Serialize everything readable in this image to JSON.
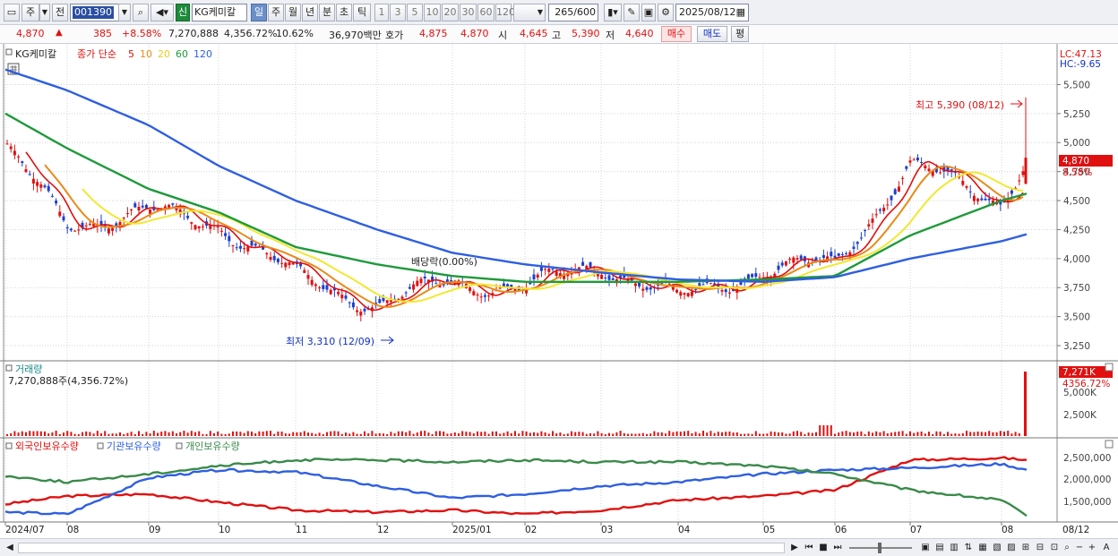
{
  "toolbar": {
    "market": "주",
    "prev_label": "전",
    "code": "001390",
    "new_badge": "신",
    "stock_name": "KG케미칼",
    "periods": [
      "일",
      "주",
      "월",
      "년",
      "분",
      "초",
      "틱"
    ],
    "active_period": "일",
    "intervals": [
      "1",
      "3",
      "5",
      "10",
      "20",
      "30",
      "60",
      "120"
    ],
    "page": "265/600",
    "date": "2025/08/12"
  },
  "quote": {
    "price": "4,870",
    "arrow": "▲",
    "change": "385",
    "change_pct": "+8.58%",
    "volume": "7,270,888",
    "volume_pct": "4,356.72%",
    "turnover": "10.62%",
    "amount": "36,970백만",
    "bid_label": "호가",
    "bid1": "4,875",
    "bid2": "4,870",
    "open_label": "시",
    "open": "4,645",
    "high_label": "고",
    "high": "5,390",
    "low_label": "저",
    "low": "4,640",
    "buy_label": "매수",
    "sell_label": "매도",
    "eval_label": "평"
  },
  "legend": {
    "name": "KG케미칼",
    "ma_label": "종가 단순",
    "ma_periods": [
      "5",
      "10",
      "20",
      "60",
      "120"
    ],
    "ma_colors": [
      "#e01010",
      "#e88a18",
      "#f2e830",
      "#1e9a3a",
      "#2f5fe0"
    ]
  },
  "price_axis": {
    "ticks": [
      "5,500",
      "5,250",
      "5,000",
      "4,750",
      "4,500",
      "4,250",
      "4,000",
      "3,750",
      "3,500",
      "3,250"
    ],
    "lc": "LC:47.13",
    "hc": "HC:-9.65",
    "current": "4,870",
    "current_pct": "8.58%"
  },
  "annotations": {
    "high": "최고 5,390 (08/12)",
    "low": "최저 3,310 (12/09)",
    "dividend": "배당락(0.00%)"
  },
  "volume_panel": {
    "title": "거래량",
    "value": "7,270,888주(4,356.72%)",
    "ticks": [
      "5,000K",
      "2,500K"
    ],
    "current": "7,271K",
    "current_pct": "4356.72%"
  },
  "holdings_panel": {
    "series": [
      "외국인보유수량",
      "기관보유수량",
      "개인보유수량"
    ],
    "colors": [
      "#e01010",
      "#2f5fe0",
      "#3a8a4a"
    ],
    "ticks": [
      "2,500,000",
      "2,000,000",
      "1,500,000"
    ]
  },
  "date_axis": [
    "2024/07",
    "08",
    "09",
    "10",
    "11",
    "12",
    "2025/01",
    "02",
    "03",
    "04",
    "05",
    "06",
    "07",
    "08"
  ],
  "date_axis_end": "08/12",
  "chart_data": {
    "type": "line",
    "title": "",
    "xlabel": "",
    "ylabel": "",
    "price_range": [
      3150,
      5650
    ],
    "x": [
      "2024/07",
      "08",
      "09",
      "10",
      "11",
      "12",
      "2025/01",
      "02",
      "03",
      "04",
      "05",
      "06",
      "07",
      "08",
      "08/12"
    ],
    "series": [
      {
        "name": "종가",
        "values": [
          4950,
          4300,
          4400,
          4300,
          3850,
          3600,
          3800,
          3750,
          3950,
          3650,
          3900,
          3950,
          4800,
          4500,
          4870
        ]
      },
      {
        "name": "60",
        "values": [
          5250,
          4950,
          4600,
          4400,
          4100,
          3950,
          3850,
          3800,
          3800,
          3800,
          3820,
          3850,
          4200,
          4500,
          4560
        ]
      },
      {
        "name": "120",
        "values": [
          5630,
          5450,
          5150,
          4800,
          4500,
          4250,
          4050,
          3950,
          3880,
          3820,
          3800,
          3840,
          4000,
          4150,
          4210
        ]
      }
    ],
    "annotations": {
      "high": 5390,
      "high_date": "08/12",
      "low": 3310,
      "low_date": "12/09"
    },
    "volume_last": "7,271K",
    "holdings": [
      {
        "name": "외국인보유수량",
        "values": [
          1450000,
          1650000,
          1700000,
          1500000,
          1300000,
          1250000,
          1300000,
          1200000,
          1300000,
          1550000,
          1650000,
          1800000,
          2550000,
          2600000,
          2550000
        ]
      },
      {
        "name": "기관보유수량",
        "values": [
          1250000,
          1200000,
          2100000,
          2300000,
          2250000,
          1900000,
          1600000,
          1700000,
          1900000,
          2000000,
          2200000,
          2300000,
          2350000,
          2450000,
          2300000
        ]
      },
      {
        "name": "개인보유수량",
        "values": [
          2150000,
          2000000,
          2200000,
          2400000,
          2550000,
          2550000,
          2500000,
          2550000,
          2500000,
          2500000,
          2400000,
          2200000,
          1800000,
          1550000,
          1150000
        ]
      }
    ]
  }
}
